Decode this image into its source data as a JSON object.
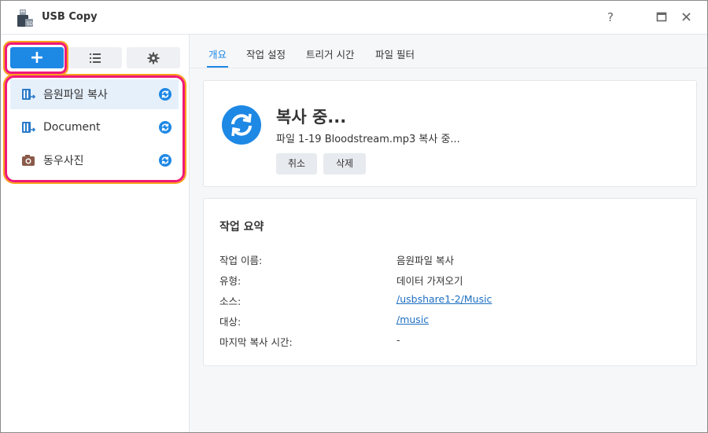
{
  "window": {
    "title": "USB Copy",
    "controls": {
      "help": "?",
      "maximize": "□",
      "close": "✕"
    }
  },
  "sidebar": {
    "toolbar": {
      "add_label": "+",
      "list_icon": "list-icon",
      "settings_icon": "gear-icon"
    },
    "tasks": [
      {
        "label": "음원파일 복사",
        "icon": "import-icon",
        "selected": true
      },
      {
        "label": "Document",
        "icon": "import-icon",
        "selected": false
      },
      {
        "label": "동우사진",
        "icon": "camera-icon",
        "selected": false
      }
    ]
  },
  "tabs": [
    {
      "label": "개요",
      "active": true
    },
    {
      "label": "작업 설정",
      "active": false
    },
    {
      "label": "트리거 시간",
      "active": false
    },
    {
      "label": "파일 필터",
      "active": false
    }
  ],
  "status": {
    "title": "복사 중...",
    "subtitle": "파일 1-19 Bloodstream.mp3 복사 중...",
    "cancel_label": "취소",
    "delete_label": "삭제"
  },
  "summary": {
    "title": "작업 요약",
    "rows": [
      {
        "key": "작업 이름:",
        "value": "음원파일 복사",
        "link": false
      },
      {
        "key": "유형:",
        "value": "데이터 가져오기",
        "link": false
      },
      {
        "key": "소스:",
        "value": "/usbshare1-2/Music",
        "link": true
      },
      {
        "key": "대상:",
        "value": "/music",
        "link": true
      },
      {
        "key": "마지막 복사 시간:",
        "value": "-",
        "link": false
      }
    ]
  },
  "colors": {
    "accent": "#1e88e5",
    "highlight_pink": "#f0187a",
    "highlight_orange": "#f7a21b"
  }
}
